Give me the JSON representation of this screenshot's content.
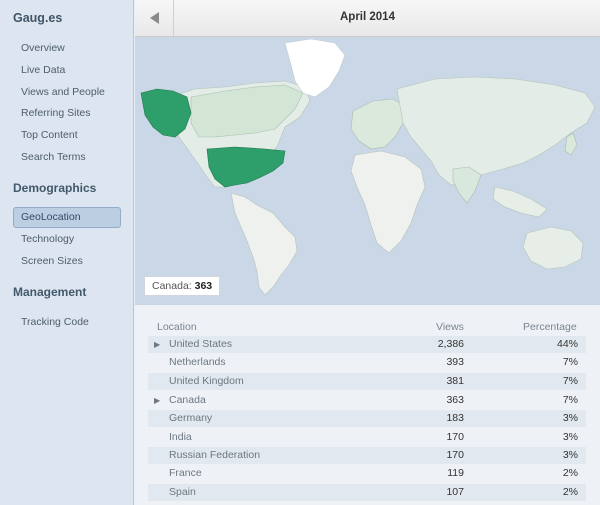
{
  "sidebar": {
    "brand": "Gaug.es",
    "items": [
      {
        "label": "Overview"
      },
      {
        "label": "Live Data"
      },
      {
        "label": "Views and People"
      },
      {
        "label": "Referring Sites"
      },
      {
        "label": "Top Content"
      },
      {
        "label": "Search Terms"
      }
    ],
    "demographics_title": "Demographics",
    "demographics_items": [
      {
        "label": "GeoLocation",
        "active": true
      },
      {
        "label": "Technology"
      },
      {
        "label": "Screen Sizes"
      }
    ],
    "management_title": "Management",
    "management_items": [
      {
        "label": "Tracking Code"
      }
    ]
  },
  "header": {
    "title": "April 2014",
    "back_icon": "triangle-left-icon"
  },
  "map": {
    "tooltip_country": "Canada:",
    "tooltip_value": "363",
    "colors": {
      "ocean": "#c9d7e6",
      "land": "#e6efe6",
      "highlight": "#2e9e6a",
      "light_green": "#cfe3d3"
    }
  },
  "table": {
    "headers": {
      "location": "Location",
      "views": "Views",
      "percentage": "Percentage"
    },
    "rows": [
      {
        "expand": "▶",
        "location": "United States",
        "views": "2,386",
        "percentage": "44%"
      },
      {
        "expand": "",
        "location": "Netherlands",
        "views": "393",
        "percentage": "7%"
      },
      {
        "expand": "",
        "location": "United Kingdom",
        "views": "381",
        "percentage": "7%"
      },
      {
        "expand": "▶",
        "location": "Canada",
        "views": "363",
        "percentage": "7%"
      },
      {
        "expand": "",
        "location": "Germany",
        "views": "183",
        "percentage": "3%"
      },
      {
        "expand": "",
        "location": "India",
        "views": "170",
        "percentage": "3%"
      },
      {
        "expand": "",
        "location": "Russian Federation",
        "views": "170",
        "percentage": "3%"
      },
      {
        "expand": "",
        "location": "France",
        "views": "119",
        "percentage": "2%"
      },
      {
        "expand": "",
        "location": "Spain",
        "views": "107",
        "percentage": "2%"
      }
    ]
  }
}
